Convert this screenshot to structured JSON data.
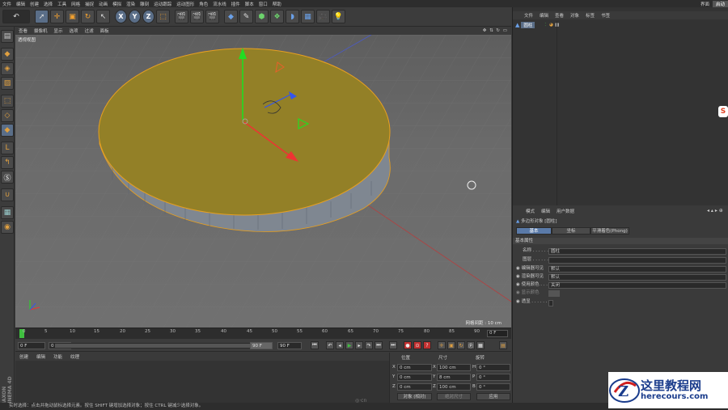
{
  "menubar": {
    "items": [
      "文件",
      "编辑",
      "创建",
      "选择",
      "工具",
      "网格",
      "捕捉",
      "动画",
      "模拟",
      "渲染",
      "雕刻",
      "运动跟踪",
      "运动图形",
      "角色",
      "流水线",
      "插件",
      "脚本",
      "窗口",
      "帮助"
    ],
    "right": [
      "界面",
      "启动"
    ]
  },
  "viewport": {
    "menu": [
      "查看",
      "摄像机",
      "显示",
      "选项",
      "过滤",
      "面板"
    ],
    "label": "透视视图",
    "grid_size": "网格间距 : 10 cm"
  },
  "timeline": {
    "ticks": [
      "0",
      "5",
      "10",
      "15",
      "20",
      "25",
      "30",
      "35",
      "40",
      "45",
      "50",
      "55",
      "60",
      "65",
      "70",
      "75",
      "80",
      "85",
      "90"
    ],
    "frame_field": "0 F",
    "current": "0 F",
    "start": "0 F",
    "end_left": "90 F",
    "end_right": "90 F"
  },
  "material": {
    "menu": [
      "创建",
      "编辑",
      "功能",
      "纹理"
    ]
  },
  "coords": {
    "headers": [
      "位置",
      "尺寸",
      "旋转"
    ],
    "rows": [
      {
        "axis": "X",
        "pos": "0 cm",
        "size_axis": "X",
        "size": "100 cm",
        "rot_axis": "H",
        "rot": "0 °"
      },
      {
        "axis": "Y",
        "pos": "0 cm",
        "size_axis": "Y",
        "size": "8 cm",
        "rot_axis": "P",
        "rot": "0 °"
      },
      {
        "axis": "Z",
        "pos": "0 cm",
        "size_axis": "Z",
        "size": "100 cm",
        "rot_axis": "B",
        "rot": "0 °"
      }
    ],
    "mode": "对象 (相对)",
    "size_mode": "绝对尺寸",
    "apply": "应用"
  },
  "object_manager": {
    "menu": [
      "文件",
      "编辑",
      "查看",
      "对象",
      "标签",
      "书签"
    ],
    "object_name": "圆柱"
  },
  "attributes": {
    "menu": [
      "模式",
      "编辑",
      "用户数据"
    ],
    "title": "多边形对象 [圆柱]",
    "tabs": [
      "基本",
      "坐标",
      "平滑着色(Phong)"
    ],
    "section": "基本属性",
    "fields": [
      {
        "label": "名称 . . . . . . . .",
        "value": "圆柱"
      },
      {
        "label": "图层 . . . . . . . .",
        "value": ""
      },
      {
        "label": "编辑器可见",
        "value": "默认"
      },
      {
        "label": "渲染器可见",
        "value": "默认"
      },
      {
        "label": "使用颜色 . . .",
        "value": "关闭"
      },
      {
        "label": "显示颜色",
        "value": ""
      },
      {
        "label": "透显 . . . . . . . .",
        "value": ""
      }
    ]
  },
  "status": "实时选择：点击并拖动鼠标选择元素。按住 SHIFT 键增加选择对象；按住 CTRL 键减少选择对象。",
  "watermark": {
    "title": "这里教程网",
    "url": "herecours.com"
  },
  "colors": {
    "cap": "#938027",
    "side": "#7f8791",
    "axis_y": "#22dd22",
    "axis_x": "#ee3333",
    "axis_z": "#3355ee"
  }
}
